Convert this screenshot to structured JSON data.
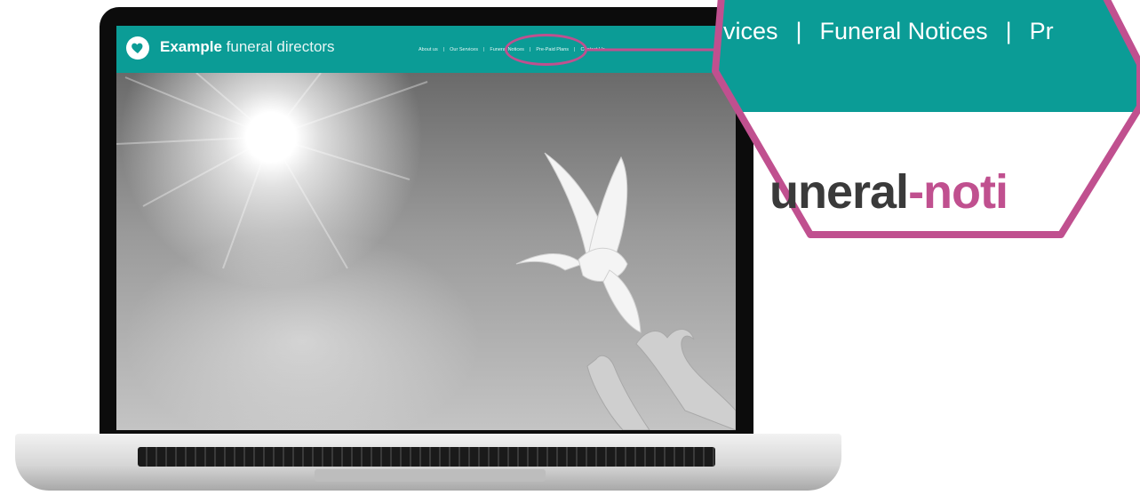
{
  "laptop_site": {
    "brand_bold": "Example",
    "brand_light": "funeral directors",
    "nav": [
      "About us",
      "|",
      "Our Services",
      "|",
      "Funeral Notices",
      "|",
      "Pre-Paid Plans",
      "|",
      "Contact Us"
    ]
  },
  "zoom": {
    "nav": [
      "vices",
      "|",
      "Funeral Notices",
      "|",
      "Pr"
    ],
    "logo_part1": "uneral",
    "logo_sep": "-",
    "logo_part2": "noti"
  },
  "colors": {
    "teal": "#0b9c96",
    "highlight": "#c0508f"
  },
  "icons": {
    "logo": "heart-icon",
    "hero": "dove-icon"
  }
}
